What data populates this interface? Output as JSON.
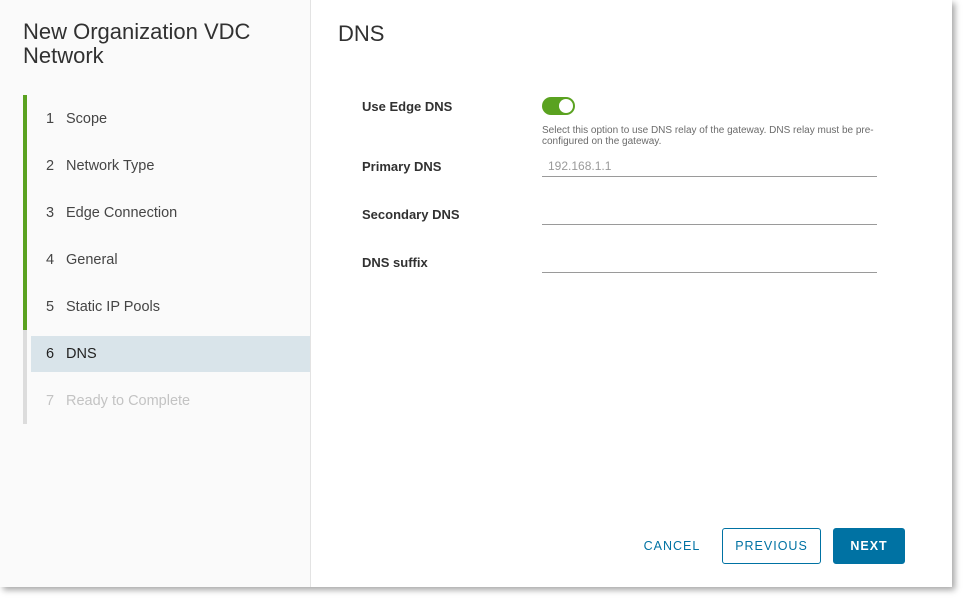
{
  "wizard": {
    "title": "New Organization VDC Network",
    "steps": [
      {
        "number": "1",
        "label": "Scope",
        "state": "completed"
      },
      {
        "number": "2",
        "label": "Network Type",
        "state": "completed"
      },
      {
        "number": "3",
        "label": "Edge Connection",
        "state": "completed"
      },
      {
        "number": "4",
        "label": "General",
        "state": "completed"
      },
      {
        "number": "5",
        "label": "Static IP Pools",
        "state": "completed"
      },
      {
        "number": "6",
        "label": "DNS",
        "state": "active"
      },
      {
        "number": "7",
        "label": "Ready to Complete",
        "state": "upcoming"
      }
    ]
  },
  "main": {
    "title": "DNS",
    "use_edge_dns": {
      "label": "Use Edge DNS",
      "enabled": true,
      "helper": "Select this option to use DNS relay of the gateway. DNS relay must be pre-configured on the gateway."
    },
    "primary_dns": {
      "label": "Primary DNS",
      "value": "",
      "placeholder": "192.168.1.1"
    },
    "secondary_dns": {
      "label": "Secondary DNS",
      "value": "",
      "placeholder": ""
    },
    "dns_suffix": {
      "label": "DNS suffix",
      "value": "",
      "placeholder": ""
    }
  },
  "footer": {
    "cancel_label": "CANCEL",
    "previous_label": "PREVIOUS",
    "next_label": "NEXT"
  },
  "colors": {
    "accent": "#0072a3",
    "completed": "#5aa220",
    "active_highlight": "#d9e4ea"
  }
}
